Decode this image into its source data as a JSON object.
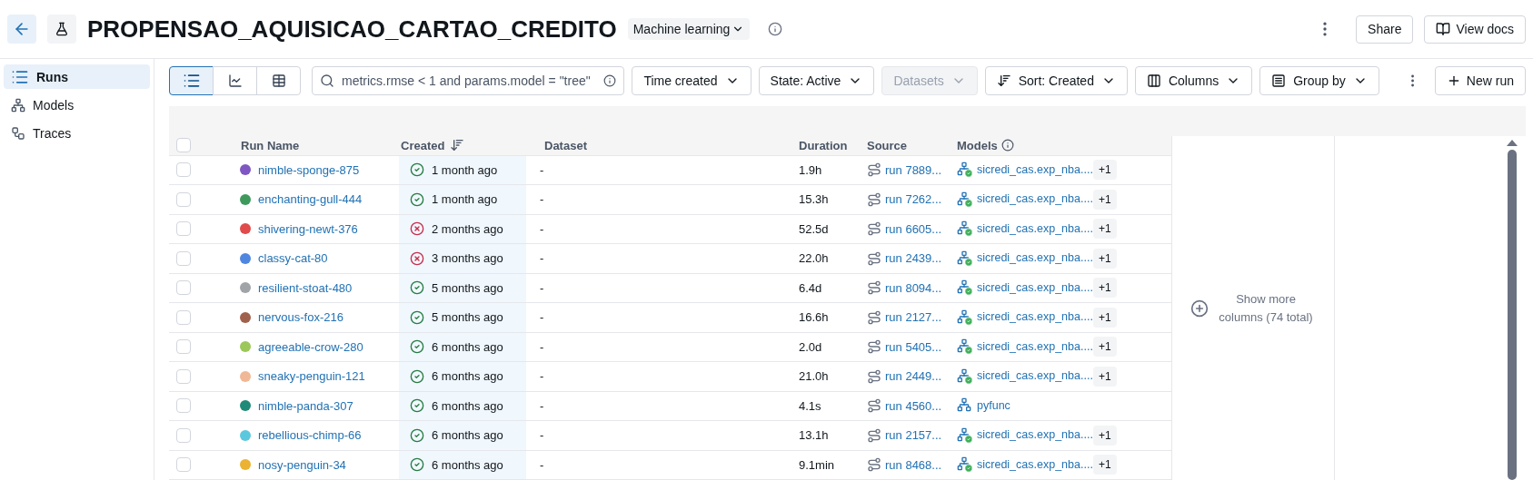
{
  "header": {
    "title": "PROPENSAO_AQUISICAO_CARTAO_CREDITO",
    "type_badge": "Machine learning",
    "buttons": [
      "Share",
      "View docs"
    ]
  },
  "sidebar": {
    "items": [
      {
        "label": "Runs",
        "kind": "runs",
        "selected": true
      },
      {
        "label": "Models",
        "kind": "models",
        "selected": false
      },
      {
        "label": "Traces",
        "kind": "traces",
        "selected": false
      }
    ]
  },
  "toolbar": {
    "views": [
      {
        "kind": "list",
        "selected": true
      },
      {
        "kind": "chart",
        "selected": false
      },
      {
        "kind": "table",
        "selected": false
      }
    ],
    "search": {
      "value": "metrics.rmse < 1 and params.model = \"tree\""
    },
    "filters": [
      {
        "label": "Time created",
        "kind": "dropdown",
        "disabled": false
      },
      {
        "label": "State: Active",
        "kind": "dropdown",
        "disabled": false
      },
      {
        "label": "Datasets",
        "kind": "dropdown",
        "disabled": true
      },
      {
        "label": "Sort: Created",
        "kind": "sort",
        "disabled": false
      },
      {
        "label": "Columns",
        "kind": "columns",
        "disabled": false
      },
      {
        "label": "Group by",
        "kind": "group",
        "disabled": false
      }
    ],
    "new_run": "New run"
  },
  "table": {
    "columns": [
      "Run Name",
      "Created",
      "Dataset",
      "Duration",
      "Source",
      "Models"
    ],
    "header_checked": false,
    "rows": [
      {
        "checked": false,
        "name": "nimble-sponge-875",
        "color": "#7e57c2",
        "failed": false,
        "created": "1 month ago",
        "dataset": "-",
        "duration": "1.9h",
        "source": "run 7889...",
        "model": "sicredi_cas.exp_nba....",
        "registered": true,
        "extra": "+1"
      },
      {
        "checked": false,
        "name": "enchanting-gull-444",
        "color": "#3d9a5c",
        "failed": false,
        "created": "1 month ago",
        "dataset": "-",
        "duration": "15.3h",
        "source": "run 7262...",
        "model": "sicredi_cas.exp_nba....",
        "registered": true,
        "extra": "+1"
      },
      {
        "checked": false,
        "name": "shivering-newt-376",
        "color": "#e04b4b",
        "failed": true,
        "created": "2 months ago",
        "dataset": "-",
        "duration": "52.5d",
        "source": "run 6605...",
        "model": "sicredi_cas.exp_nba....",
        "registered": true,
        "extra": "+1"
      },
      {
        "checked": false,
        "name": "classy-cat-80",
        "color": "#4f86e0",
        "failed": true,
        "created": "3 months ago",
        "dataset": "-",
        "duration": "22.0h",
        "source": "run 2439...",
        "model": "sicredi_cas.exp_nba....",
        "registered": true,
        "extra": "+1"
      },
      {
        "checked": false,
        "name": "resilient-stoat-480",
        "color": "#a0a4a8",
        "failed": false,
        "created": "5 months ago",
        "dataset": "-",
        "duration": "6.4d",
        "source": "run 8094...",
        "model": "sicredi_cas.exp_nba....",
        "registered": true,
        "extra": "+1"
      },
      {
        "checked": false,
        "name": "nervous-fox-216",
        "color": "#a0614c",
        "failed": false,
        "created": "5 months ago",
        "dataset": "-",
        "duration": "16.6h",
        "source": "run 2127...",
        "model": "sicredi_cas.exp_nba....",
        "registered": true,
        "extra": "+1"
      },
      {
        "checked": false,
        "name": "agreeable-crow-280",
        "color": "#9cc75a",
        "failed": false,
        "created": "6 months ago",
        "dataset": "-",
        "duration": "2.0d",
        "source": "run 5405...",
        "model": "sicredi_cas.exp_nba....",
        "registered": true,
        "extra": "+1"
      },
      {
        "checked": false,
        "name": "sneaky-penguin-121",
        "color": "#f0b896",
        "failed": false,
        "created": "6 months ago",
        "dataset": "-",
        "duration": "21.0h",
        "source": "run 2449...",
        "model": "sicredi_cas.exp_nba....",
        "registered": true,
        "extra": "+1"
      },
      {
        "checked": false,
        "name": "nimble-panda-307",
        "color": "#1f8a78",
        "failed": false,
        "created": "6 months ago",
        "dataset": "-",
        "duration": "4.1s",
        "source": "run 4560...",
        "model": "pyfunc",
        "registered": false
      },
      {
        "checked": false,
        "name": "rebellious-chimp-66",
        "color": "#5cc8de",
        "failed": false,
        "created": "6 months ago",
        "dataset": "-",
        "duration": "13.1h",
        "source": "run 2157...",
        "model": "sicredi_cas.exp_nba....",
        "registered": true,
        "extra": "+1"
      },
      {
        "checked": false,
        "name": "nosy-penguin-34",
        "color": "#ebb233",
        "failed": false,
        "created": "6 months ago",
        "dataset": "-",
        "duration": "9.1min",
        "source": "run 8468...",
        "model": "sicredi_cas.exp_nba....",
        "registered": true,
        "extra": "+1"
      }
    ],
    "show_more": "Show more columns (74 total)"
  }
}
